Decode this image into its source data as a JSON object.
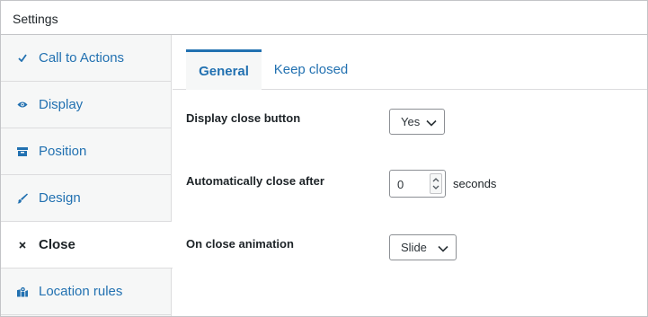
{
  "panel": {
    "title": "Settings"
  },
  "sidebar": {
    "items": [
      {
        "label": "Call to Actions",
        "icon": "checkmark-icon"
      },
      {
        "label": "Display",
        "icon": "eye-icon"
      },
      {
        "label": "Position",
        "icon": "archive-box-icon"
      },
      {
        "label": "Design",
        "icon": "paintbrush-icon"
      },
      {
        "label": "Close",
        "icon": "close-icon",
        "active": true
      },
      {
        "label": "Location rules",
        "icon": "map-pin-icon"
      }
    ]
  },
  "tabs": [
    {
      "label": "General",
      "active": true
    },
    {
      "label": "Keep closed",
      "active": false
    }
  ],
  "fields": {
    "display_close_button": {
      "label": "Display close button",
      "value": "Yes"
    },
    "auto_close": {
      "label": "Automatically close after",
      "value": "0",
      "suffix": "seconds"
    },
    "close_animation": {
      "label": "On close animation",
      "value": "Slide"
    }
  },
  "colors": {
    "accent": "#2271b1",
    "text": "#1d2327",
    "sidebar_bg": "#f6f7f7",
    "border": "#c3c4c7"
  }
}
